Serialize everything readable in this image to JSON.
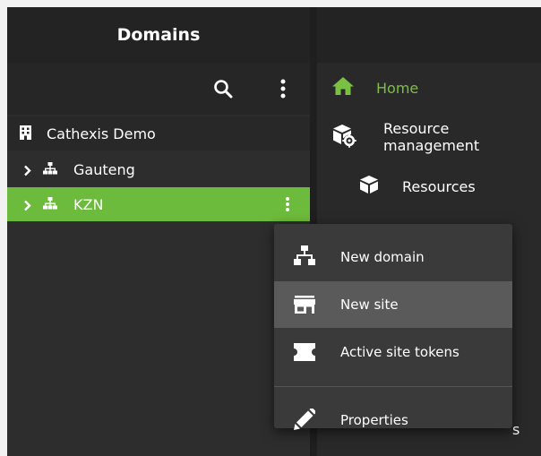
{
  "left_panel": {
    "title": "Domains",
    "tree": {
      "root": {
        "label": "Cathexis Demo"
      },
      "items": [
        {
          "label": "Gauteng"
        },
        {
          "label": "KZN",
          "selected": true
        }
      ]
    }
  },
  "nav": {
    "items": [
      {
        "label": "Home",
        "icon": "home-icon",
        "active": true
      },
      {
        "label": "Resource management",
        "icon": "cubes-gear-icon"
      },
      {
        "label": "Resources",
        "icon": "cube-icon"
      }
    ],
    "partial_label": "s"
  },
  "context_menu": {
    "items": [
      {
        "label": "New domain",
        "icon": "sitemap-icon"
      },
      {
        "label": "New site",
        "icon": "storefront-icon",
        "highlighted": true
      },
      {
        "label": "Active site tokens",
        "icon": "ticket-icon"
      },
      {
        "label": "Properties",
        "icon": "pencil-icon"
      }
    ]
  },
  "colors": {
    "accent": "#6dbb3c",
    "home_active": "#7ac043",
    "menu_bg": "#3a3a3a",
    "menu_highlight": "#5a5a5a"
  }
}
